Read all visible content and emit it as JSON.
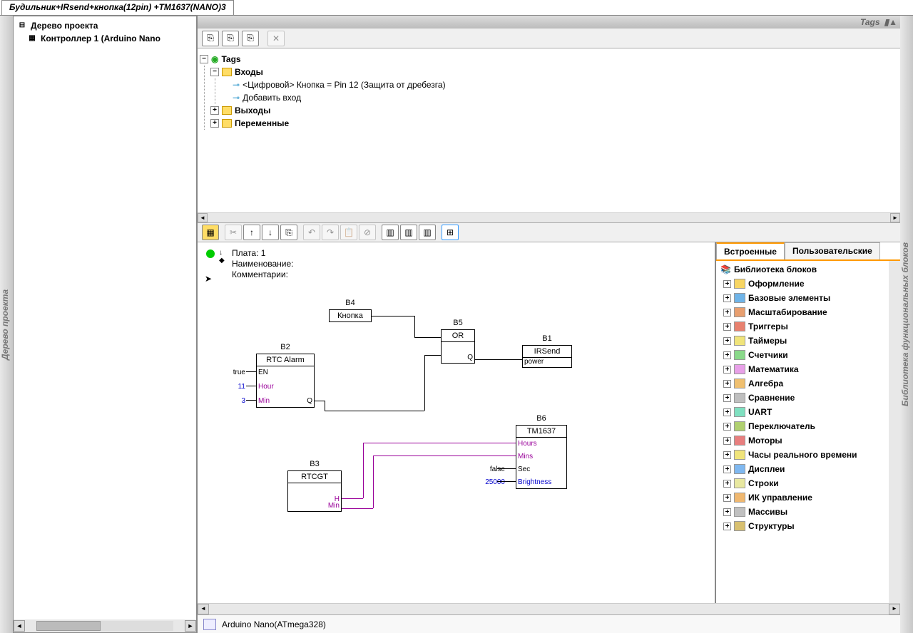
{
  "tab_title": "Будильник+IRsend+кнопка(12pin) +TM1637(NANO)3",
  "left_vbar": "Дерево проекта",
  "right_vbar": "Библиотека функциональных блоков",
  "project_tree": {
    "root": "Дерево проекта",
    "controller": "Контроллер 1 (Arduino Nano"
  },
  "tags_header": "Tags",
  "tags_tree": {
    "root": "Tags",
    "inputs": "Входы",
    "input1": "<Цифровой> Кнопка = Pin 12 (Защита от дребезга)",
    "add_input": "Добавить вход",
    "outputs": "Выходы",
    "vars": "Переменные"
  },
  "canvas_info": {
    "plate": "Плата: 1",
    "name": "Наименование:",
    "comment": "Комментарии:"
  },
  "blocks": {
    "b1": {
      "id": "B1",
      "title": "IRSend",
      "pin_power": "power"
    },
    "b2": {
      "id": "B2",
      "title": "RTC Alarm",
      "pin_en": "EN",
      "pin_hour": "Hour",
      "pin_min": "Min",
      "pin_q": "Q",
      "v_true": "true",
      "v_11": "11",
      "v_3": "3"
    },
    "b3": {
      "id": "B3",
      "title": "RTCGT",
      "pin_h": "H",
      "pin_min": "Min"
    },
    "b4": {
      "id": "B4",
      "title": "Кнопка"
    },
    "b5": {
      "id": "B5",
      "title": "OR",
      "pin_q": "Q"
    },
    "b6": {
      "id": "B6",
      "title": "TM1637",
      "pin_hours": "Hours",
      "pin_mins": "Mins",
      "pin_sec": "Sec",
      "pin_bri": "Brightness",
      "v_false": "false",
      "v_25000": "25000"
    }
  },
  "right": {
    "tab1": "Встроенные",
    "tab2": "Пользовательские",
    "root": "Библиотека блоков",
    "items": [
      "Оформление",
      "Базовые элементы",
      "Масштабирование",
      "Триггеры",
      "Таймеры",
      "Счетчики",
      "Математика",
      "Алгебра",
      "Сравнение",
      "UART",
      "Переключатель",
      "Моторы",
      "Часы реального времени",
      "Дисплеи",
      "Строки",
      "ИК управление",
      "Массивы",
      "Структуры"
    ]
  },
  "icon_colors": [
    "#f7d562",
    "#6fb4e8",
    "#e89f6f",
    "#e8816f",
    "#f0e47a",
    "#8ad98a",
    "#e8a0e8",
    "#f0c070",
    "#bfbfbf",
    "#7fe0c0",
    "#b0d070",
    "#e87f7f",
    "#f0e47a",
    "#7fb8f0",
    "#e8e8a0",
    "#f0b870",
    "#c0c0c0",
    "#d8c070"
  ],
  "status": "Arduino Nano(ATmega328)"
}
